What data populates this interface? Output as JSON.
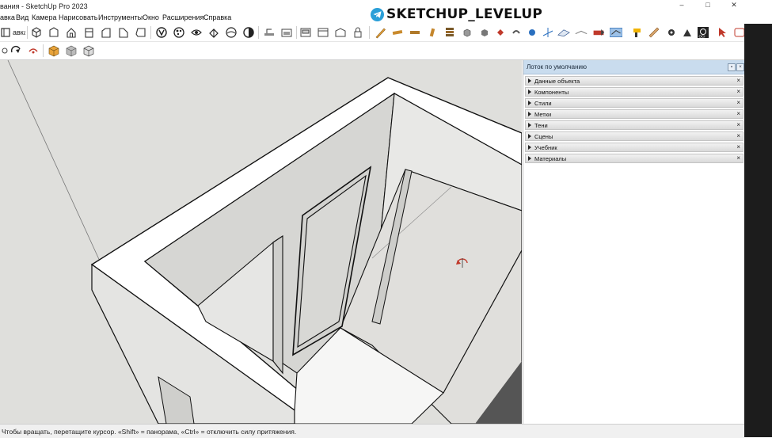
{
  "window": {
    "title": "вания - SketchUp Pro 2023",
    "controls": [
      "–",
      "□",
      "✕"
    ]
  },
  "watermark": {
    "text": "SKETCHUP_LEVELUP",
    "icon": "telegram-icon"
  },
  "menu": [
    {
      "label": "авка"
    },
    {
      "label": "Вид"
    },
    {
      "label": "Камера"
    },
    {
      "label": "Нарисовать"
    },
    {
      "label": "Инструменты"
    },
    {
      "label": "Окно"
    },
    {
      "label": "Расширения"
    },
    {
      "label": "Справка"
    }
  ],
  "toolbar": {
    "row1_icons": [
      "views-icon",
      "iso-view-icon",
      "top-view-icon",
      "front-view-icon",
      "right-view-icon",
      "back-view-icon",
      "left-view-icon",
      "xray-style-icon",
      "wireframe-style-icon",
      "hidden-line-style-icon",
      "shaded-style-icon",
      "textured-style-icon",
      "monochrome-style-icon",
      "section-plane-icon",
      "section-cut-icon",
      "section-fill-icon",
      "warehouse-icon",
      "extension-warehouse-icon",
      "layout-icon",
      "lock-icon",
      "pencil-icon",
      "ruler-icon",
      "tape-icon",
      "marker-icon",
      "stack-icon",
      "cube-icon",
      "plugin-red-icon",
      "plugin-gray-icon",
      "plugin-blue-icon",
      "axes-icon",
      "stairs-icon",
      "paint-icon",
      "tool-plugin-icon",
      "highlight-plugin-icon",
      "drill-icon",
      "plank-icon",
      "gear-icon",
      "profile-icon",
      "oci-icon",
      "select-arrow-icon",
      "extra-tool-icon"
    ],
    "row2_icons": [
      "orbit-icon",
      "pan-icon",
      "box-component-icon",
      "solid-box-icon",
      "outline-box-icon"
    ]
  },
  "tray": {
    "title": "Лоток по умолчанию",
    "panels": [
      {
        "label": "Данные объекта"
      },
      {
        "label": "Компоненты"
      },
      {
        "label": "Стили"
      },
      {
        "label": "Метки"
      },
      {
        "label": "Тени"
      },
      {
        "label": "Сцены"
      },
      {
        "label": "Учебник"
      },
      {
        "label": "Материалы"
      }
    ],
    "close_glyph": "×",
    "pin_glyph": "▪"
  },
  "status": {
    "text": "Чтобы вращать, перетащите курсор. «Shift» = панорама, «Ctrl» = отключить силу притяжения."
  },
  "viewport": {
    "cursor": "orbit-cursor-icon"
  }
}
